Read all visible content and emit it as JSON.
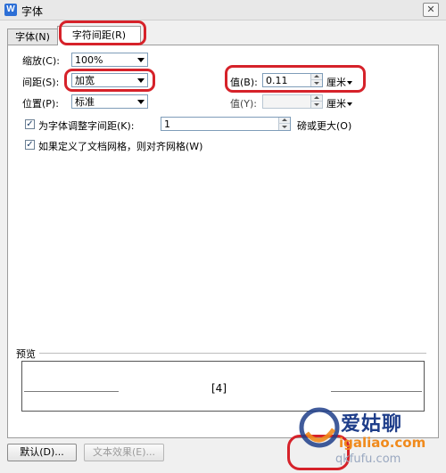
{
  "window": {
    "title": "字体",
    "app_icon_letter": "W"
  },
  "tabs": [
    {
      "label": "字体(N)",
      "active": false
    },
    {
      "label": "字符间距(R)",
      "active": true
    }
  ],
  "scale": {
    "label": "缩放(C):",
    "value": "100%"
  },
  "spacing": {
    "label": "间距(S):",
    "value": "加宽",
    "value_label": "值(B):",
    "amount": "0.11",
    "unit": "厘米"
  },
  "position": {
    "label": "位置(P):",
    "value": "标准",
    "value_label": "值(Y):",
    "amount": "",
    "unit": "厘米"
  },
  "kerning": {
    "checked": true,
    "label": "为字体调整字间距(K):",
    "value": "1",
    "suffix": "磅或更大(O)"
  },
  "grid": {
    "checked": true,
    "label": "如果定义了文档网格，则对齐网格(W)"
  },
  "preview": {
    "label": "预览",
    "sample": "[4]"
  },
  "buttons": {
    "default": "默认(D)...",
    "text_effect": "文本效果(E)..."
  },
  "watermark": {
    "brand": "爱姑聊",
    "url": "igaliao.com",
    "faded_url": "qkfufu.com"
  },
  "colors": {
    "annotation_red": "#d6222a",
    "watermark_blue": "#1f3e8a",
    "watermark_orange": "#f08a1c"
  }
}
